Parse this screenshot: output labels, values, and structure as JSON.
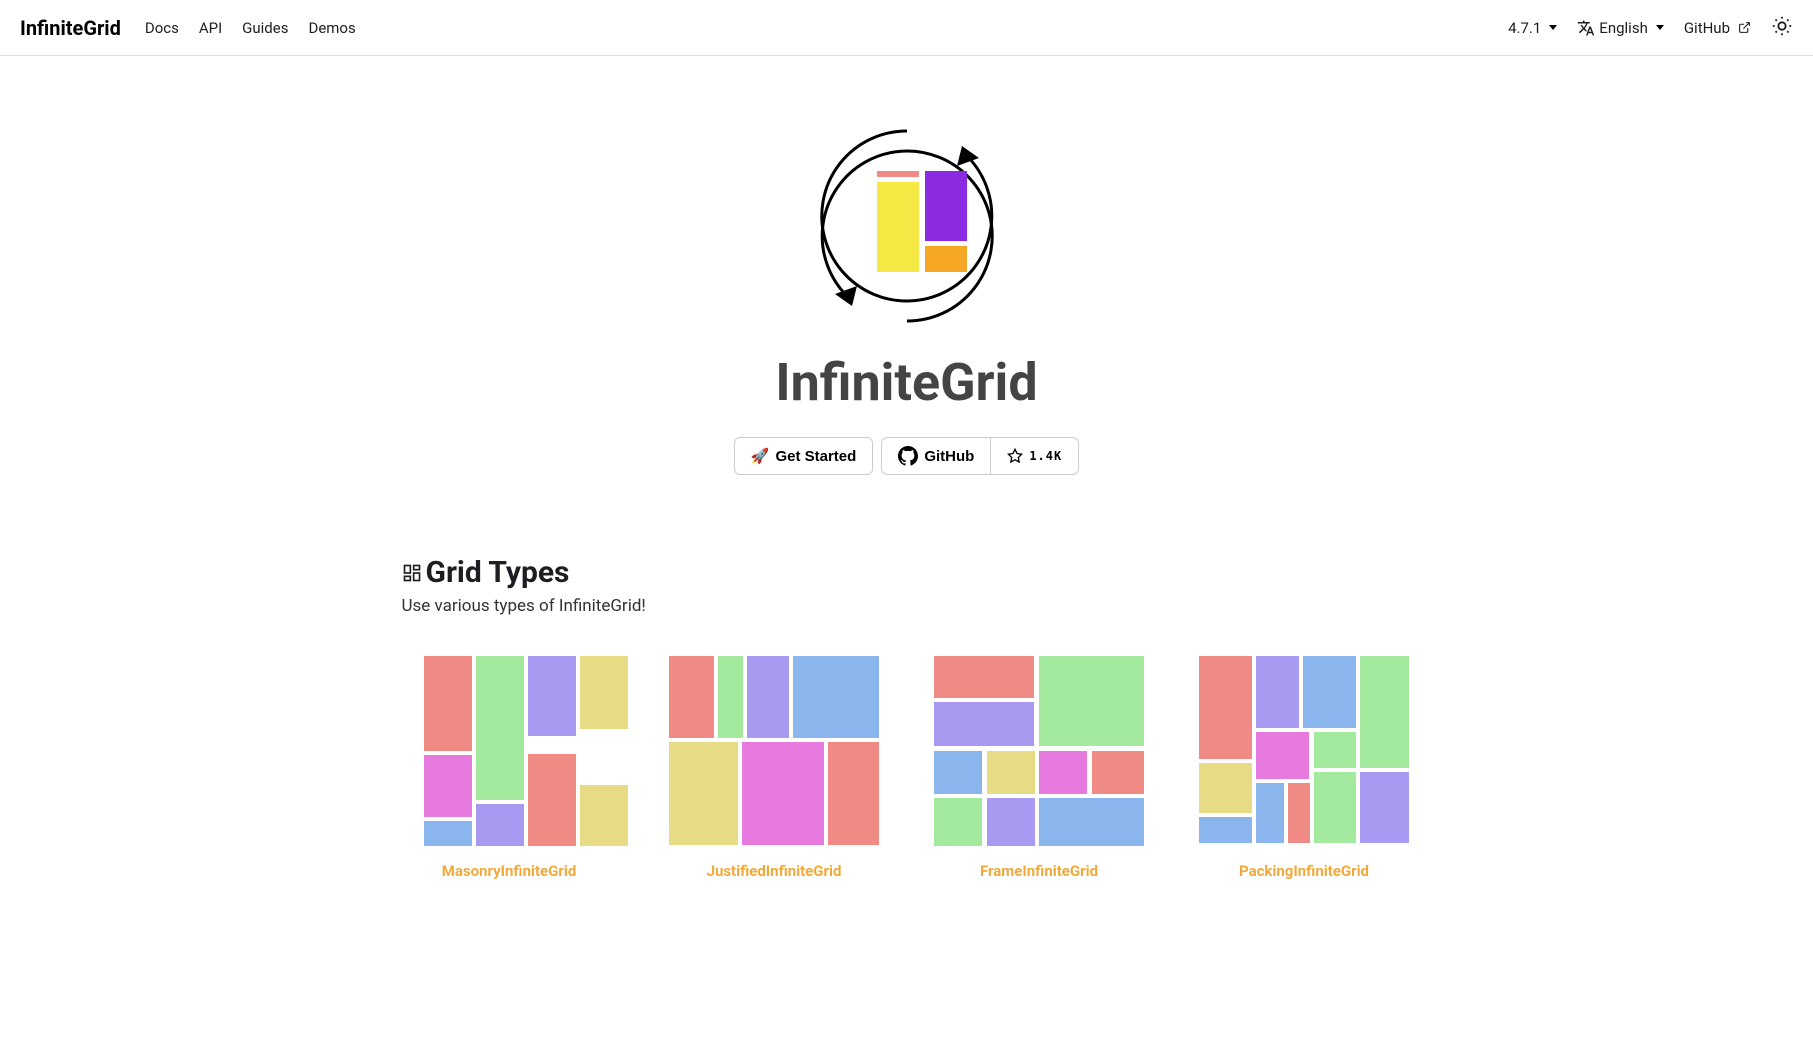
{
  "navbar": {
    "brand": "InfiniteGrid",
    "links": [
      "Docs",
      "API",
      "Guides",
      "Demos"
    ],
    "version": "4.7.1",
    "language": "English",
    "github": "GitHub"
  },
  "hero": {
    "title": "InfiniteGrid",
    "getStarted": "Get Started",
    "github": "GitHub",
    "stars": "1.4K"
  },
  "section": {
    "title": "Grid Types",
    "subtitle": "Use various types of InfiniteGrid!"
  },
  "gridTypes": [
    "MasonryInfiniteGrid",
    "JustifiedInfiniteGrid",
    "FrameInfiniteGrid",
    "PackingInfiniteGrid"
  ]
}
